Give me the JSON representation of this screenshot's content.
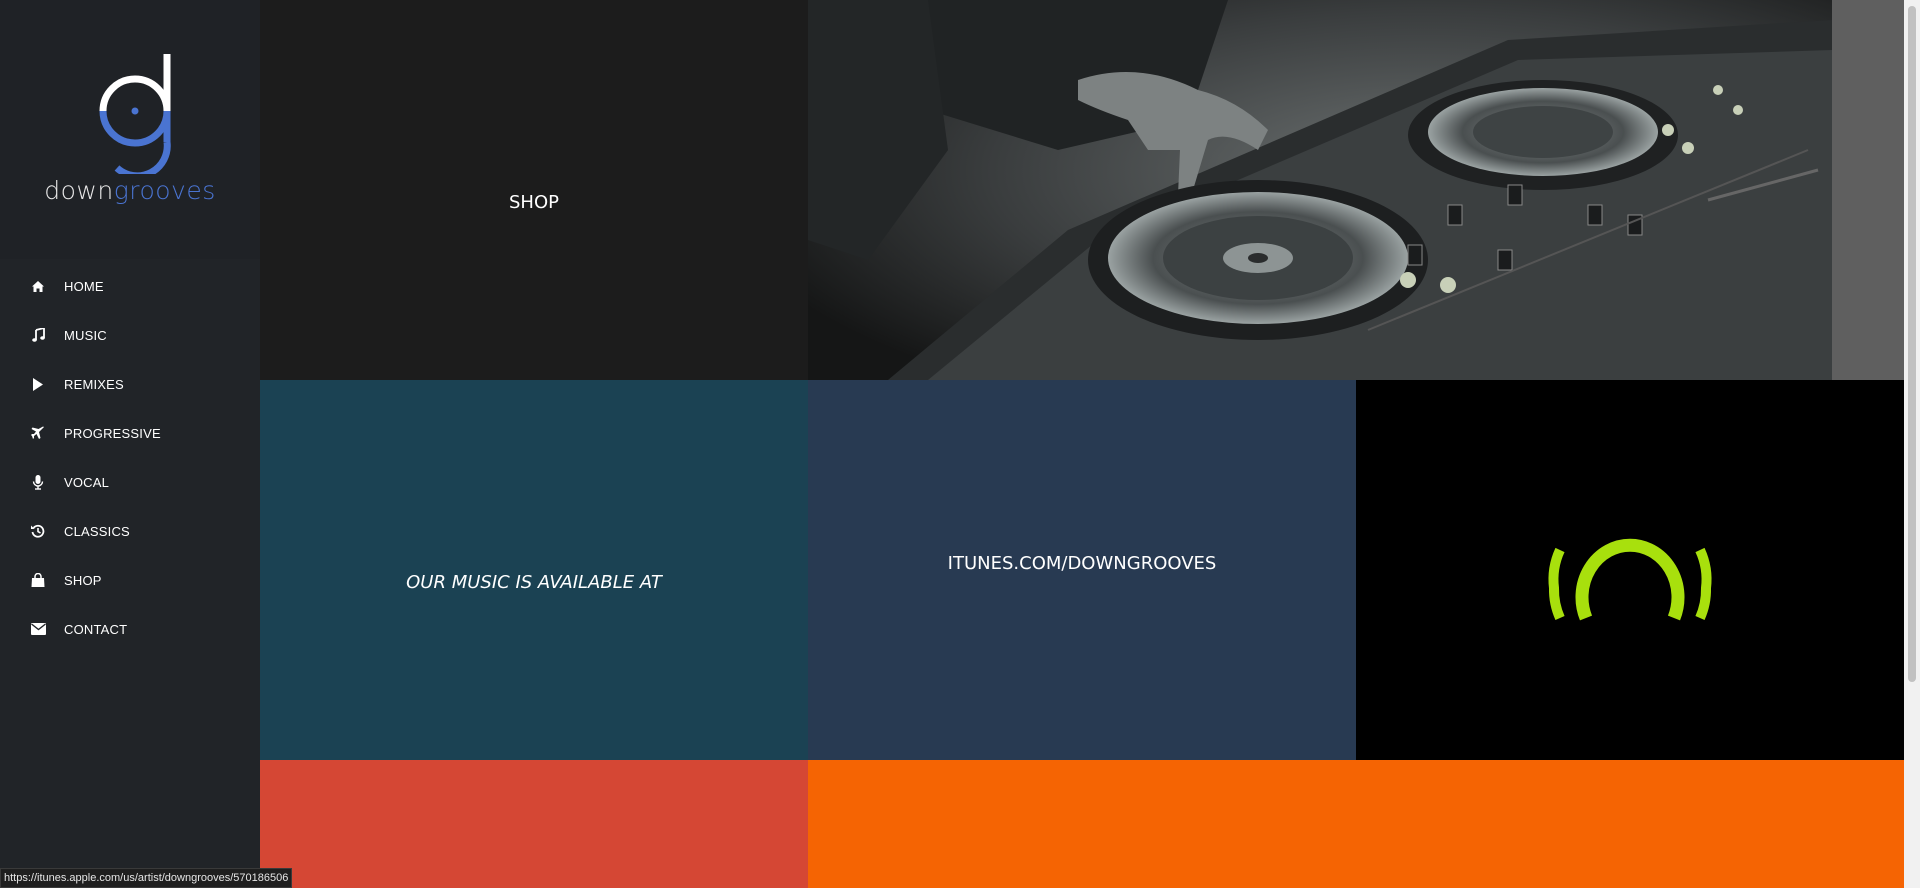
{
  "brand": {
    "logo_text_part1": "down",
    "logo_text_part2": "grooves",
    "accent_color": "#4a74d1"
  },
  "sidebar": {
    "items": [
      {
        "label": "HOME",
        "icon": "home-icon"
      },
      {
        "label": "MUSIC",
        "icon": "music-note-icon"
      },
      {
        "label": "REMIXES",
        "icon": "play-icon"
      },
      {
        "label": "PROGRESSIVE",
        "icon": "plane-icon"
      },
      {
        "label": "VOCAL",
        "icon": "microphone-icon"
      },
      {
        "label": "CLASSICS",
        "icon": "history-icon"
      },
      {
        "label": "SHOP",
        "icon": "shopping-bag-icon"
      },
      {
        "label": "CONTACT",
        "icon": "envelope-icon"
      }
    ]
  },
  "tiles": {
    "shop_label": "SHOP",
    "available_label": "OUR MUSIC IS AVAILABLE AT",
    "itunes_label": "ITUNES.COM/DOWNGROOVES",
    "beatport_icon": "beatport-logo-icon",
    "beatport_color": "#a8e00d"
  },
  "statusbar": {
    "url": "https://itunes.apple.com/us/artist/downgrooves/570186506"
  }
}
